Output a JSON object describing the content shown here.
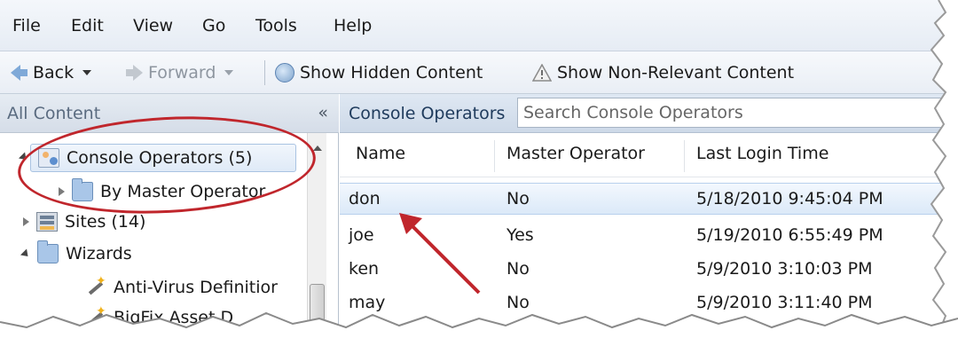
{
  "menubar": {
    "items": [
      "File",
      "Edit",
      "View",
      "Go",
      "Tools",
      "Help"
    ]
  },
  "toolbar": {
    "back_label": "Back",
    "forward_label": "Forward",
    "show_hidden_label": "Show Hidden Content",
    "show_nonrelevant_label": "Show Non-Relevant Content"
  },
  "left_pane": {
    "title": "All Content",
    "collapse_glyph": "«",
    "tree": [
      {
        "label": "Console Operators (5)",
        "icon": "console-operators-icon",
        "expanded": true
      },
      {
        "label": "By Master Operator",
        "icon": "folder-icon",
        "expanded": false
      },
      {
        "label": "Sites (14)",
        "icon": "sites-icon",
        "expanded": false
      },
      {
        "label": "Wizards",
        "icon": "folder-icon",
        "expanded": true
      },
      {
        "label": "Anti-Virus Definitior",
        "icon": "wizard-icon"
      },
      {
        "label": "BigFix Asset D",
        "icon": "wizard-icon"
      }
    ]
  },
  "right_pane": {
    "title": "Console Operators",
    "search_placeholder": "Search Console Operators",
    "columns": [
      "Name",
      "Master Operator",
      "Last Login Time"
    ],
    "rows": [
      {
        "name": "don",
        "master": "No",
        "last_login": "5/18/2010 9:45:04 PM",
        "selected": true
      },
      {
        "name": "joe",
        "master": "Yes",
        "last_login": "5/19/2010 6:55:49 PM"
      },
      {
        "name": "ken",
        "master": "No",
        "last_login": "5/9/2010 3:10:03 PM"
      },
      {
        "name": "may",
        "master": "No",
        "last_login": "5/9/2010 3:11:40 PM"
      }
    ]
  },
  "colors": {
    "annotation_red": "#c0262c",
    "selection_blue": "#dbe9f8",
    "header_blue": "#cdd9e8"
  }
}
